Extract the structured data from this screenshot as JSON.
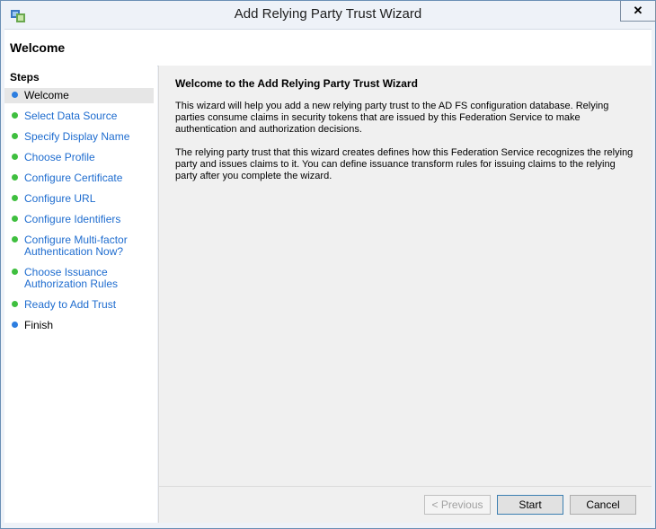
{
  "window": {
    "title": "Add Relying Party Trust Wizard",
    "close_label": "✕"
  },
  "header": {
    "title": "Welcome"
  },
  "sidebar": {
    "title": "Steps",
    "steps": [
      {
        "label": "Welcome",
        "state": "current"
      },
      {
        "label": "Select Data Source",
        "state": "link"
      },
      {
        "label": "Specify Display Name",
        "state": "link"
      },
      {
        "label": "Choose Profile",
        "state": "link"
      },
      {
        "label": "Configure Certificate",
        "state": "link"
      },
      {
        "label": "Configure URL",
        "state": "link"
      },
      {
        "label": "Configure Identifiers",
        "state": "link"
      },
      {
        "label": "Configure Multi-factor\nAuthentication Now?",
        "state": "link"
      },
      {
        "label": "Choose Issuance\nAuthorization Rules",
        "state": "link"
      },
      {
        "label": "Ready to Add Trust",
        "state": "link"
      },
      {
        "label": "Finish",
        "state": "finish"
      }
    ]
  },
  "main": {
    "heading": "Welcome to the Add Relying Party Trust Wizard",
    "paragraph1": "This wizard will help you add a new relying party trust to the AD FS configuration database.  Relying parties consume claims in security tokens that are issued by this Federation Service to make authentication and authorization decisions.",
    "paragraph2": "The relying party trust that this wizard creates defines how this Federation Service recognizes the relying party and issues claims to it. You can define issuance transform rules for issuing claims to the relying party after you complete the wizard."
  },
  "buttons": {
    "previous": "< Previous",
    "start": "Start",
    "cancel": "Cancel"
  },
  "colors": {
    "link": "#1e6ccf",
    "step_done": "#3fbf3f",
    "step_current": "#2d7ee0"
  }
}
